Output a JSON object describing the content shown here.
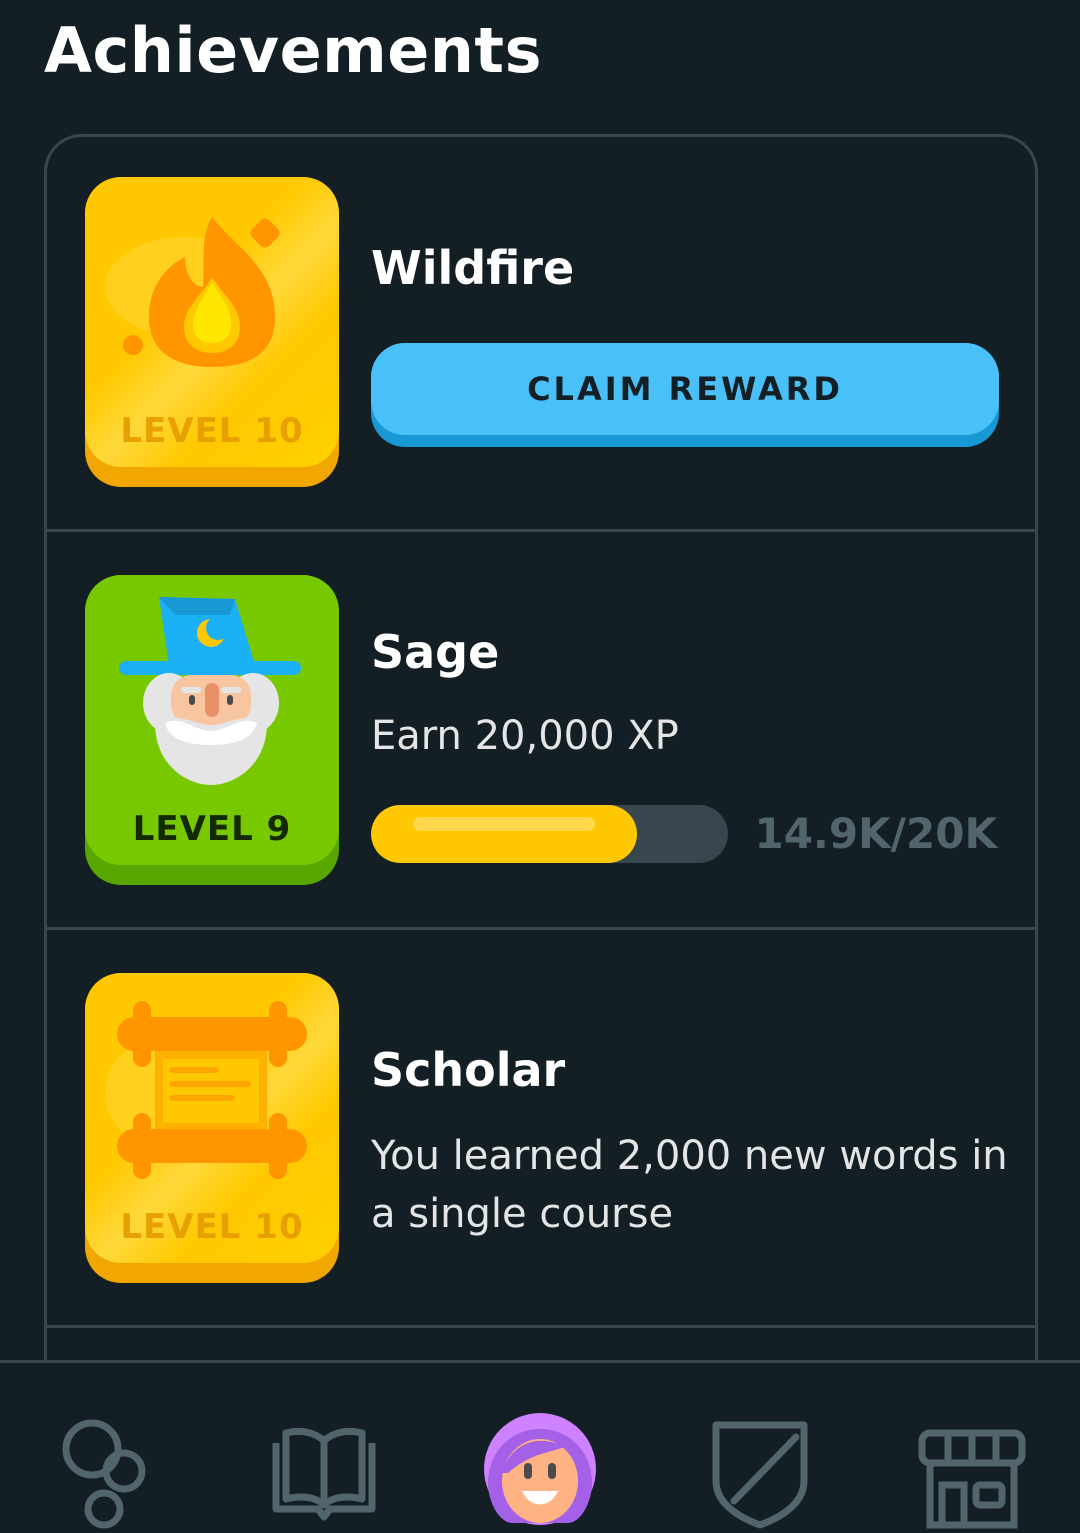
{
  "header": {
    "title": "Achievements"
  },
  "achievements": [
    {
      "title": "Wildfire",
      "level": "LEVEL 10",
      "button": "CLAIM REWARD",
      "badge_color": "#ffc800",
      "icon": "flame-icon"
    },
    {
      "title": "Sage",
      "level": "LEVEL 9",
      "description": "Earn 20,000 XP",
      "progress": 0.745,
      "progress_label": "14.9K/20K",
      "badge_color": "#78c800",
      "icon": "wizard-icon"
    },
    {
      "title": "Scholar",
      "level": "LEVEL 10",
      "description": "You learned 2,000 new words in a single course",
      "badge_color": "#ffc800",
      "icon": "scroll-icon"
    }
  ],
  "nav": {
    "items": [
      "learn-icon",
      "stories-icon",
      "profile-icon",
      "leagues-icon",
      "shop-icon"
    ],
    "active": "profile-icon"
  },
  "colors": {
    "background": "#131f24",
    "border": "#37464f",
    "accent_blue": "#49c0f8",
    "gold": "#ffc800",
    "green": "#78c800"
  }
}
